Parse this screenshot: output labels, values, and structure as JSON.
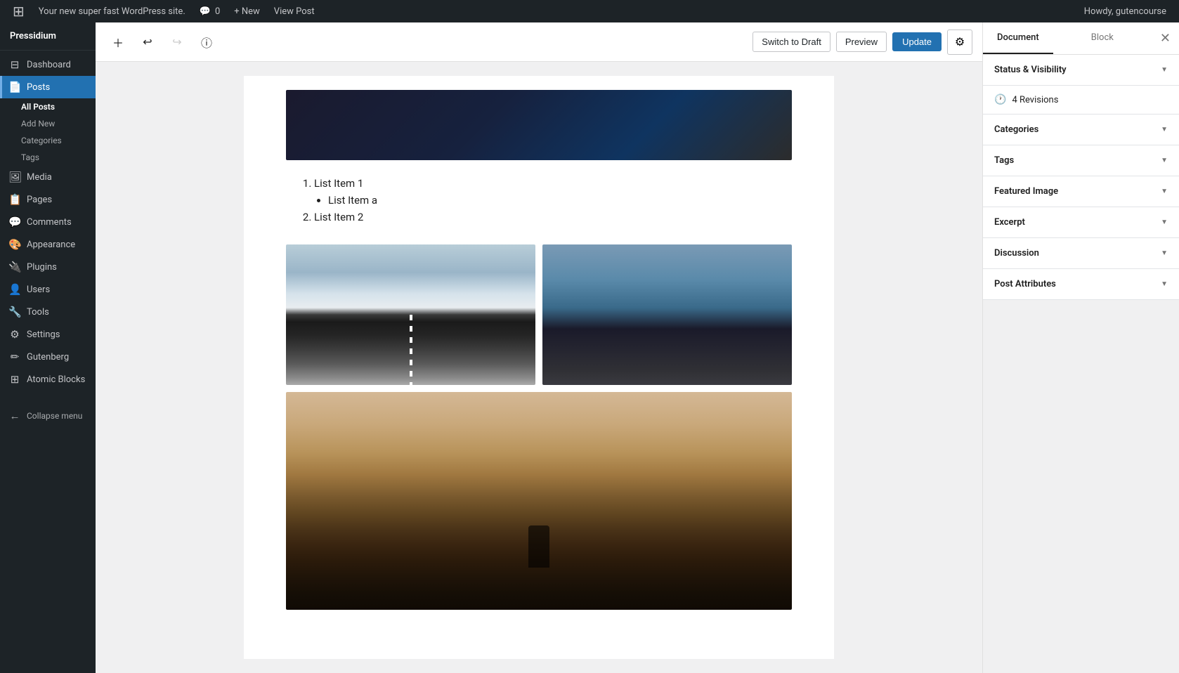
{
  "adminbar": {
    "wp_logo": "⊞",
    "site_name": "Your new super fast WordPress site.",
    "comments_icon": "💬",
    "comments_count": "0",
    "new_label": "+ New",
    "view_post_label": "View Post",
    "howdy": "Howdy, gutencourse"
  },
  "sidebar": {
    "logo_icon": "⊞",
    "site_label": "Pressidium",
    "items": [
      {
        "id": "dashboard",
        "icon": "⊟",
        "label": "Dashboard"
      },
      {
        "id": "posts",
        "icon": "📄",
        "label": "Posts",
        "active": true
      },
      {
        "id": "media",
        "icon": "🖼",
        "label": "Media"
      },
      {
        "id": "pages",
        "icon": "📋",
        "label": "Pages"
      },
      {
        "id": "comments",
        "icon": "💬",
        "label": "Comments"
      },
      {
        "id": "appearance",
        "icon": "🎨",
        "label": "Appearance"
      },
      {
        "id": "plugins",
        "icon": "🔌",
        "label": "Plugins"
      },
      {
        "id": "users",
        "icon": "👤",
        "label": "Users"
      },
      {
        "id": "tools",
        "icon": "🔧",
        "label": "Tools"
      },
      {
        "id": "settings",
        "icon": "⚙",
        "label": "Settings"
      },
      {
        "id": "gutenberg",
        "icon": "✏",
        "label": "Gutenberg"
      },
      {
        "id": "atomic-blocks",
        "icon": "⊞",
        "label": "Atomic Blocks"
      }
    ],
    "posts_sub": [
      {
        "id": "all-posts",
        "label": "All Posts",
        "active": true
      },
      {
        "id": "add-new",
        "label": "Add New"
      },
      {
        "id": "categories",
        "label": "Categories"
      },
      {
        "id": "tags",
        "label": "Tags"
      }
    ],
    "collapse_label": "Collapse menu"
  },
  "toolbar": {
    "add_block_icon": "+",
    "undo_icon": "↩",
    "redo_icon": "↪",
    "info_icon": "ℹ",
    "switch_draft_label": "Switch to Draft",
    "preview_label": "Preview",
    "update_label": "Update",
    "settings_icon": "⚙"
  },
  "editor": {
    "list_items": [
      {
        "type": "ordered",
        "text": "List Item 1"
      },
      {
        "type": "ordered-sub",
        "text": "List Item a"
      },
      {
        "type": "ordered",
        "text": "List Item 2"
      }
    ]
  },
  "right_panel": {
    "document_tab": "Document",
    "block_tab": "Block",
    "close_icon": "✕",
    "sections": [
      {
        "id": "status-visibility",
        "title": "Status & Visibility",
        "arrow": "▼"
      },
      {
        "id": "revisions",
        "title": "4 Revisions",
        "icon": "🕐",
        "is_revisions": true
      },
      {
        "id": "categories",
        "title": "Categories",
        "arrow": "▼"
      },
      {
        "id": "tags",
        "title": "Tags",
        "arrow": "▼"
      },
      {
        "id": "featured-image",
        "title": "Featured Image",
        "arrow": "▼"
      },
      {
        "id": "excerpt",
        "title": "Excerpt",
        "arrow": "▼"
      },
      {
        "id": "discussion",
        "title": "Discussion",
        "arrow": "▼"
      },
      {
        "id": "post-attributes",
        "title": "Post Attributes",
        "arrow": "▼"
      }
    ]
  }
}
